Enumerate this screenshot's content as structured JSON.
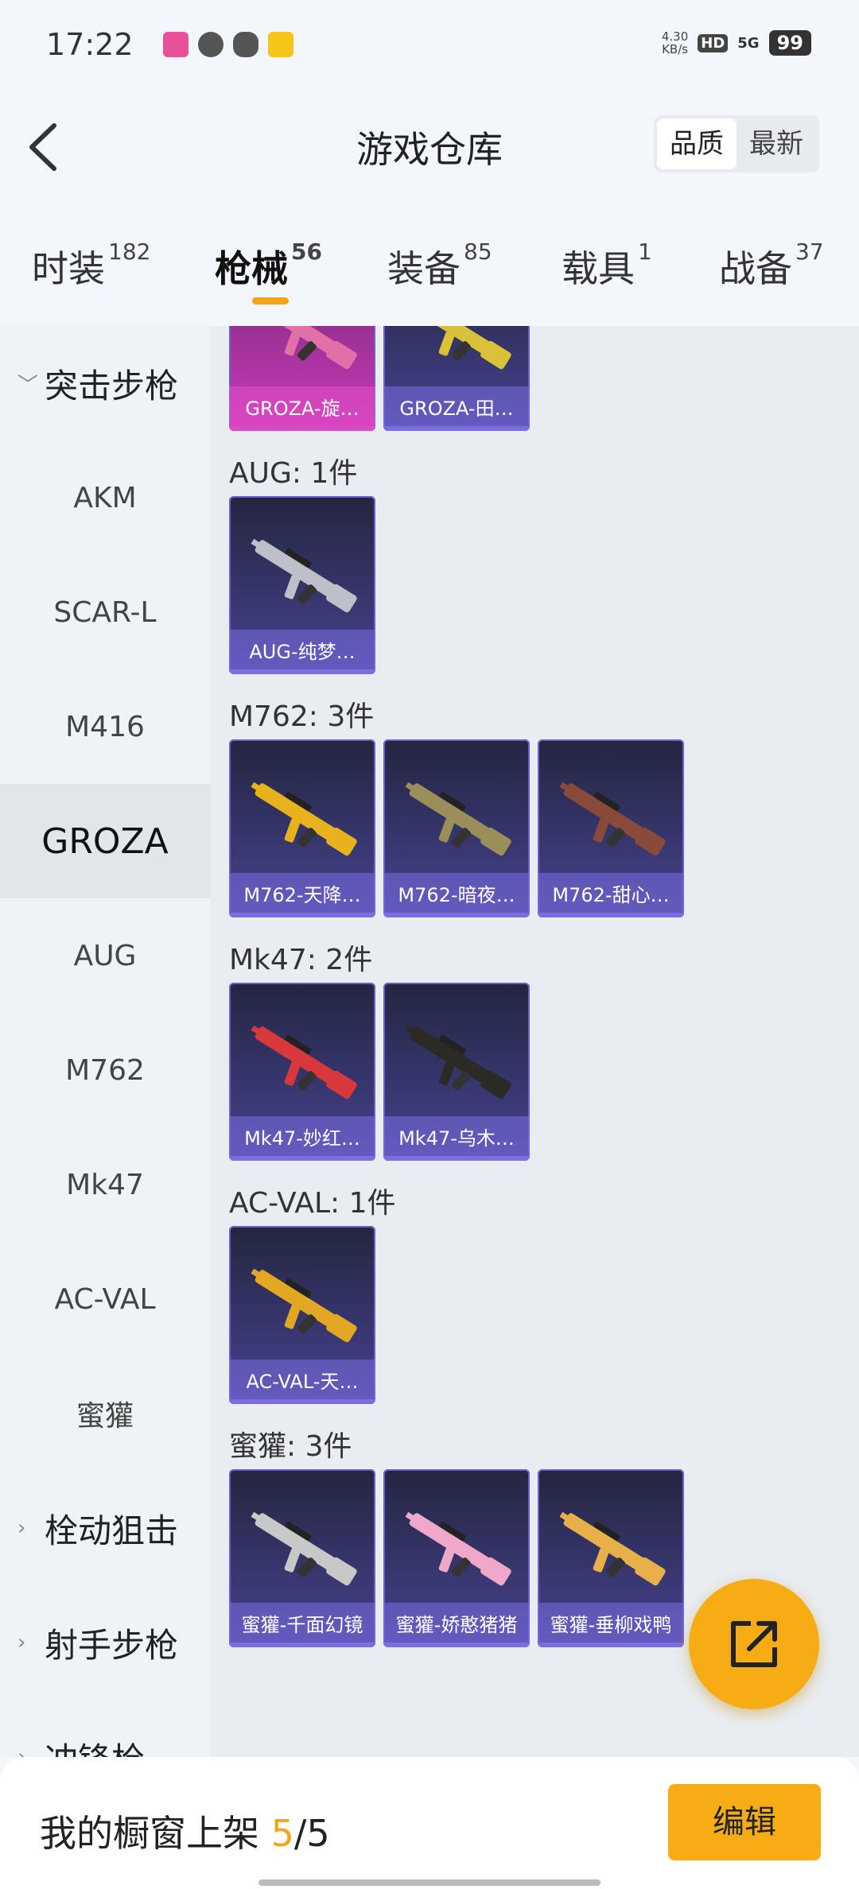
{
  "status_bar": {
    "time": "17:22",
    "net_speed_value": "4.30",
    "net_speed_unit": "KB/s",
    "hd_badge": "HD",
    "network": "5G",
    "battery": "99"
  },
  "header": {
    "title": "游戏仓库",
    "sort_options": [
      "品质",
      "最新"
    ],
    "sort_selected": "品质"
  },
  "tabs": [
    {
      "label": "时装",
      "count": "182"
    },
    {
      "label": "枪械",
      "count": "56",
      "active": true
    },
    {
      "label": "装备",
      "count": "85"
    },
    {
      "label": "载具",
      "count": "1"
    },
    {
      "label": "战备",
      "count": "37"
    }
  ],
  "sidebar": {
    "items": [
      {
        "label": "突击步枪",
        "type": "group",
        "expanded": true
      },
      {
        "label": "AKM"
      },
      {
        "label": "SCAR-L"
      },
      {
        "label": "M416"
      },
      {
        "label": "GROZA",
        "active": true
      },
      {
        "label": "AUG"
      },
      {
        "label": "M762"
      },
      {
        "label": "Mk47"
      },
      {
        "label": "AC-VAL"
      },
      {
        "label": "蜜獾"
      },
      {
        "label": "栓动狙击",
        "type": "group"
      },
      {
        "label": "射手步枪",
        "type": "group"
      },
      {
        "label": "冲锋枪",
        "type": "group"
      }
    ]
  },
  "sections": [
    {
      "title": "",
      "items": [
        {
          "name": "GROZA-旋…",
          "quality": "pink",
          "color": "#e26fa8"
        },
        {
          "name": "GROZA-田…",
          "quality": "purple",
          "color": "#d9c23a"
        }
      ]
    },
    {
      "title": "AUG: 1件",
      "items": [
        {
          "name": "AUG-纯梦…",
          "quality": "purple",
          "color": "#bfbfc8"
        }
      ]
    },
    {
      "title": "M762: 3件",
      "items": [
        {
          "name": "M762-天降…",
          "quality": "purple",
          "color": "#e8b21c"
        },
        {
          "name": "M762-暗夜…",
          "quality": "purple",
          "color": "#9a8e5a"
        },
        {
          "name": "M762-甜心…",
          "quality": "purple",
          "color": "#8a4a3a"
        }
      ]
    },
    {
      "title": "Mk47: 2件",
      "items": [
        {
          "name": "Mk47-妙红…",
          "quality": "purple",
          "color": "#d8383c"
        },
        {
          "name": "Mk47-乌木…",
          "quality": "purple",
          "color": "#2c2a24"
        }
      ]
    },
    {
      "title": "AC-VAL: 1件",
      "items": [
        {
          "name": "AC-VAL-天…",
          "quality": "purple",
          "color": "#e2a824"
        }
      ]
    },
    {
      "title": "蜜獾: 3件",
      "items": [
        {
          "name": "蜜獾-千面幻镜",
          "quality": "purple",
          "color": "#c8c8c8"
        },
        {
          "name": "蜜獾-娇憨猪猪",
          "quality": "purple",
          "color": "#f0a8c8"
        },
        {
          "name": "蜜獾-垂柳戏鸭",
          "quality": "purple",
          "color": "#e8b048"
        }
      ]
    }
  ],
  "bottom": {
    "showcase_label": "我的橱窗上架",
    "showcase_current": "5",
    "showcase_sep": "/",
    "showcase_total": "5",
    "edit_label": "编辑"
  },
  "colors": {
    "accent": "#f6ac14",
    "card_purple": "#4a44a0",
    "card_pink": "#c83ab8"
  }
}
